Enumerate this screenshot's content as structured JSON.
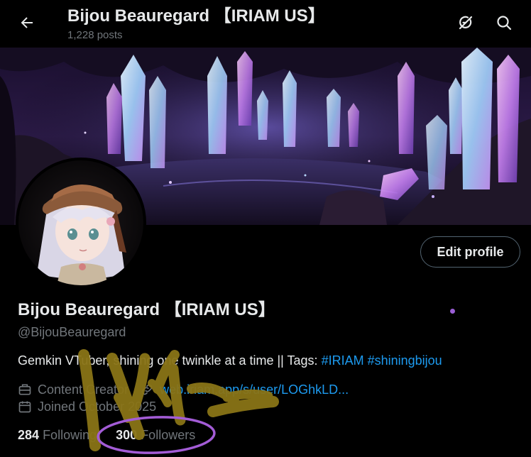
{
  "header": {
    "title": "Bijou Beauregard 【IRIAM US】",
    "post_count": "1,228 posts"
  },
  "icons": {
    "back": "arrow-left-icon",
    "grok": "grok-icon",
    "search": "search-icon",
    "category": "briefcase-icon",
    "link": "link-icon",
    "calendar": "calendar-icon"
  },
  "profile": {
    "display_name": "Bijou Beauregard 【IRIAM US】",
    "handle": "@BijouBeauregard",
    "bio_text": "Gemkin VTuber, shining one twinkle at a time || Tags: ",
    "bio_hashtags": [
      "#IRIAM",
      "#shiningbijou"
    ],
    "category": "Content Creator",
    "website": "web.iriam.app/s/user/LOGhkLD...",
    "joined": "Joined October 2025",
    "following_count": "284",
    "following_label": "Following",
    "followers_count": "300",
    "followers_label": "Followers"
  },
  "buttons": {
    "edit_profile": "Edit profile"
  },
  "colors": {
    "background": "#000000",
    "text_primary": "#e7e9ea",
    "text_secondary": "#71767b",
    "link": "#1d9bf0",
    "button_border": "#536471",
    "annotation_gold": "#8a7417",
    "annotation_purple": "#a35cd6"
  }
}
